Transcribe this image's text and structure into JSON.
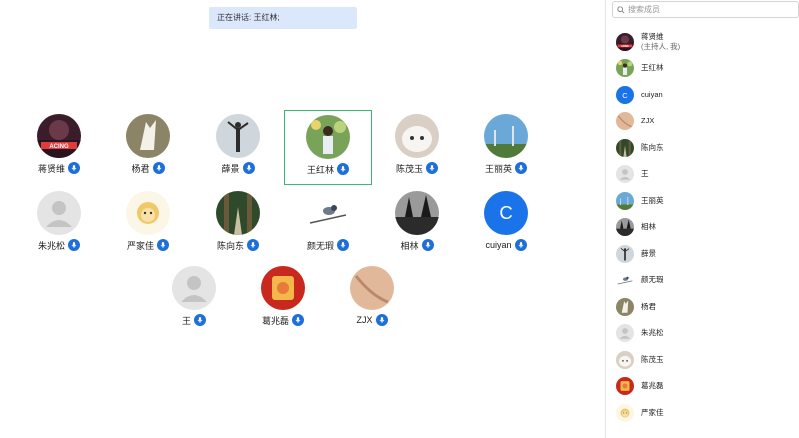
{
  "banner": {
    "text": "正在讲话: 王红林;"
  },
  "gallery": {
    "participants": [
      {
        "name": "蒋贤维",
        "avatar_icon": "racing-poster-avatar",
        "active": false
      },
      {
        "name": "杨君",
        "avatar_icon": "white-figure-avatar",
        "active": false
      },
      {
        "name": "薛景",
        "avatar_icon": "statue-avatar",
        "active": false
      },
      {
        "name": "王红林",
        "avatar_icon": "girl-flowers-avatar",
        "active": true
      },
      {
        "name": "陈茂玉",
        "avatar_icon": "white-cat-avatar",
        "active": false
      },
      {
        "name": "王丽英",
        "avatar_icon": "sky-trees-avatar",
        "active": false
      },
      {
        "name": "朱兆松",
        "avatar_icon": "default-person-avatar",
        "active": false
      },
      {
        "name": "严家佳",
        "avatar_icon": "cartoon-lion-avatar",
        "active": false
      },
      {
        "name": "陈向东",
        "avatar_icon": "forest-path-avatar",
        "active": false
      },
      {
        "name": "颜无瑕",
        "avatar_icon": "bird-branch-avatar",
        "active": false
      },
      {
        "name": "相林",
        "avatar_icon": "bw-trees-avatar",
        "active": false
      },
      {
        "name": "cuiyan",
        "avatar_icon": "letter-c-avatar",
        "avatar_letter": "C",
        "active": false
      },
      {
        "name": "王",
        "avatar_icon": "default-person-avatar",
        "active": false
      },
      {
        "name": "葛兆磊",
        "avatar_icon": "red-newyear-avatar",
        "active": false
      },
      {
        "name": "ZJX",
        "avatar_icon": "skin-texture-avatar",
        "active": false
      }
    ]
  },
  "sidebar": {
    "search_placeholder": "搜索成员",
    "members": [
      {
        "name": "蒋贤维",
        "sub": "(主持人, 我)",
        "avatar_icon": "racing-poster-avatar"
      },
      {
        "name": "王红林",
        "sub": "",
        "avatar_icon": "girl-flowers-avatar"
      },
      {
        "name": "cuiyan",
        "sub": "",
        "avatar_icon": "letter-c-avatar",
        "avatar_letter": "C"
      },
      {
        "name": "ZJX",
        "sub": "",
        "avatar_icon": "skin-texture-avatar"
      },
      {
        "name": "陈向东",
        "sub": "",
        "avatar_icon": "forest-path-avatar"
      },
      {
        "name": "王",
        "sub": "",
        "avatar_icon": "default-person-avatar"
      },
      {
        "name": "王丽英",
        "sub": "",
        "avatar_icon": "sky-trees-avatar"
      },
      {
        "name": "相林",
        "sub": "",
        "avatar_icon": "bw-trees-avatar"
      },
      {
        "name": "薛景",
        "sub": "",
        "avatar_icon": "statue-avatar"
      },
      {
        "name": "颜无瑕",
        "sub": "",
        "avatar_icon": "bird-branch-avatar"
      },
      {
        "name": "杨君",
        "sub": "",
        "avatar_icon": "white-figure-avatar"
      },
      {
        "name": "朱兆松",
        "sub": "",
        "avatar_icon": "default-person-avatar"
      },
      {
        "name": "陈茂玉",
        "sub": "",
        "avatar_icon": "white-cat-avatar"
      },
      {
        "name": "葛兆磊",
        "sub": "",
        "avatar_icon": "red-newyear-avatar"
      },
      {
        "name": "严家佳",
        "sub": "",
        "avatar_icon": "cartoon-lion-avatar"
      }
    ]
  },
  "colors": {
    "active_border": "#3cb872",
    "mic_badge": "#1e6fd9",
    "banner_bg": "#dbe7fb",
    "letter_avatar": "#1a73e8"
  }
}
